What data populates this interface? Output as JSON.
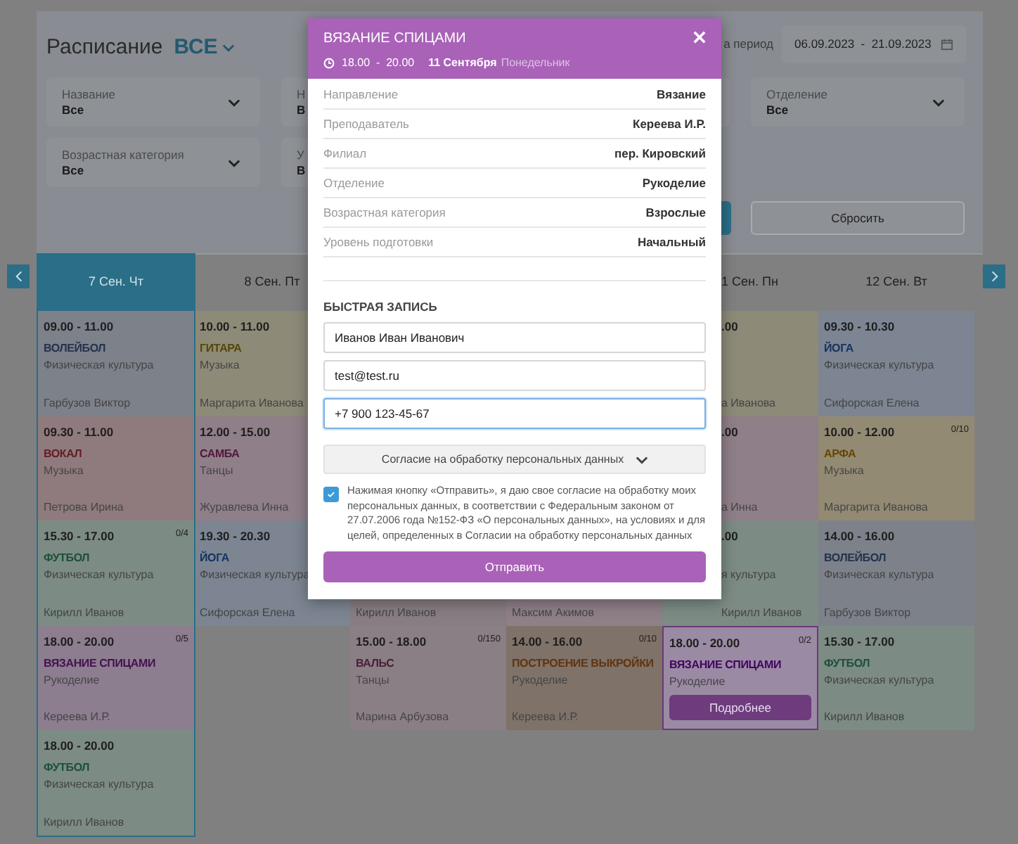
{
  "header": {
    "title": "Расписание",
    "scope": "ВСЕ"
  },
  "period": {
    "label": "а период",
    "value": "06.09.2023  -  21.09.2023"
  },
  "filter_rows": [
    [
      {
        "label": "Название",
        "value": "Все"
      },
      {
        "label": "Н",
        "value": "В"
      },
      {},
      {
        "label": "Отделение",
        "value": "Все"
      }
    ],
    [
      {
        "label": "Возрастная категория",
        "value": "Все"
      },
      {
        "label": "У",
        "value": "В"
      }
    ]
  ],
  "actions": [
    {
      "kind": "primary"
    },
    {
      "kind": "secondary",
      "label": "Сбросить"
    }
  ],
  "days": [
    {
      "label": "7 Сен. Чт",
      "selected": true,
      "covered": false,
      "cells": [
        {
          "time": "09.00 - 11.00",
          "title": "ВОЛЕЙБОЛ",
          "category": "Физическая культура",
          "teacher": "Гарбузов Виктор",
          "color": "#7d8189",
          "selected": false,
          "covered": false
        },
        {
          "time": "09.30 - 11.00",
          "title": "ВОКАЛ",
          "category": "Музыка",
          "teacher": "Петрова Ирина",
          "color": "#8f7b7d",
          "selected": false,
          "covered": false
        },
        {
          "time": "15.30 - 17.00",
          "count": "0/4",
          "title": "ФУТБОЛ",
          "category": "Физическая культура",
          "teacher": "Кирилл Иванов",
          "color": "#7c8b84",
          "selected": false,
          "covered": false
        },
        {
          "time": "18.00 - 20.00",
          "count": "0/5",
          "title": "ВЯЗАНИЕ СПИЦАМИ",
          "category": "Рукоделие",
          "teacher": "Кереева И.Р.",
          "color": "#8c7d8f",
          "selected": false,
          "covered": false
        },
        {
          "time": "18.00 - 20.00",
          "title": "ФУТБОЛ",
          "category": "Физическая культура",
          "teacher": "Кирилл Иванов",
          "color": "#7c8b84",
          "selected": false,
          "covered": false
        }
      ]
    },
    {
      "label": "8 Сен. Пт",
      "selected": false,
      "covered": false,
      "cells": [
        {
          "time": "10.00 - 11.00",
          "title": "ГИТАРА",
          "category": "Музыка",
          "teacher": "Маргарита Иванова",
          "color": "#8e8a78",
          "selected": false,
          "covered": false
        },
        {
          "time": "12.00 - 15.00",
          "title": "САМБА",
          "category": "Танцы",
          "teacher": "Журавлева Инна",
          "color": "#8f7f89",
          "selected": false,
          "covered": false
        },
        {
          "time": "19.30 - 20.30",
          "title": "ЙОГА",
          "category": "Физическая культура",
          "teacher": "Сифорская Елена",
          "color": "#7c8591",
          "selected": false,
          "covered": false
        }
      ]
    },
    {
      "cells": [
        {},
        {},
        {
          "teacher": "Кирилл Иванов",
          "color": "#877d83",
          "selected": false,
          "covered": false
        },
        {
          "time": "15.00 - 18.00",
          "count": "0/150",
          "title": "ВАЛЬС",
          "category": "Танцы",
          "teacher": "Марина Арбузова",
          "color": "#8b7f86",
          "selected": false,
          "covered": false
        }
      ]
    },
    {
      "cells": [
        {},
        {},
        {
          "teacher": "Максим Акимов",
          "color": "#8f7f88",
          "selected": false,
          "covered": false
        },
        {
          "time": "14.00 - 16.00",
          "count": "0/10",
          "title": "ПОСТРОЕНИЕ ВЫКРОЙКИ",
          "category": "Рукоделие",
          "teacher": "Кереева И.Р.",
          "color": "#7f7268",
          "selected": false,
          "covered": false
        }
      ]
    },
    {
      "label": "1 Сен. Пн",
      "selected": false,
      "covered": true,
      "cells": [
        {
          "time": ".00",
          "teacher": "а Иванова",
          "color": "#8e8a78",
          "selected": false,
          "covered": true
        },
        {
          "time": ".00",
          "teacher": "а Инна",
          "color": "#8f7f89",
          "selected": false,
          "covered": true
        },
        {
          "time": ".00",
          "category": "я культура",
          "teacher": "Кирилл Иванов",
          "color": "#7c8b84",
          "selected": false,
          "covered": true
        },
        {
          "time": "18.00 - 20.00",
          "count": "0/2",
          "title": "ВЯЗАНИЕ СПИЦАМИ",
          "category": "Рукоделие",
          "button": "Подробнее",
          "color": "#9b8aa4",
          "selected": true,
          "covered": false
        }
      ]
    },
    {
      "label": "12 Сен. Вт",
      "selected": false,
      "covered": false,
      "cells": [
        {
          "time": "09.30 - 10.30",
          "title": "ЙОГА",
          "category": "Физическая культура",
          "teacher": "Сифорская Елена",
          "color": "#7c8591",
          "selected": false,
          "covered": false
        },
        {
          "time": "10.00 - 12.00",
          "count": "0/10",
          "title": "АРФА",
          "category": "Музыка",
          "teacher": "Маргарита Иванова",
          "color": "#938a74",
          "selected": false,
          "covered": false
        },
        {
          "time": "14.00 - 16.00",
          "title": "ВОЛЕЙБОЛ",
          "category": "Физическая культура",
          "teacher": "Гарбузов Виктор",
          "color": "#7d8189",
          "selected": false,
          "covered": false
        },
        {
          "time": "15.30 - 17.00",
          "title": "ФУТБОЛ",
          "category": "Физическая культура",
          "teacher": "Кирилл Иванов",
          "color": "#7c8b84",
          "selected": false,
          "covered": false
        }
      ]
    }
  ],
  "modal": {
    "title": "ВЯЗАНИЕ СПИЦАМИ",
    "time": "18.00  -  20.00",
    "date": "11 Сентября",
    "weekday": "Понедельник",
    "details": [
      {
        "label": "Направление",
        "value": "Вязание"
      },
      {
        "label": "Преподаватель",
        "value": "Кереева И.Р."
      },
      {
        "label": "Филиал",
        "value": "пер. Кировский"
      },
      {
        "label": "Отделение",
        "value": "Рукоделие"
      },
      {
        "label": "Возрастная категория",
        "value": "Взрослые"
      },
      {
        "label": "Уровень подготовки",
        "value": "Начальный"
      }
    ],
    "booking": {
      "title": "БЫСТРАЯ ЗАПИСЬ",
      "fields": [
        {
          "value": "Иванов Иван Иванович",
          "focused": false
        },
        {
          "value": "test@test.ru",
          "focused": false
        },
        {
          "value": "+7 900 123-45-67",
          "focused": true
        }
      ],
      "consent_toggle": "Согласие на обработку персональных данных",
      "consent": {
        "checked": true,
        "text": "Нажимая кнопку «Отправить», я даю свое согласие на обработку моих персональных данных, в соответствии с Федеральным законом от 27.07.2006 года №152-ФЗ «О персональных данных», на условиях и для целей, определенных в Согласии на обработку персональных данных"
      },
      "submit": "Отправить"
    }
  }
}
